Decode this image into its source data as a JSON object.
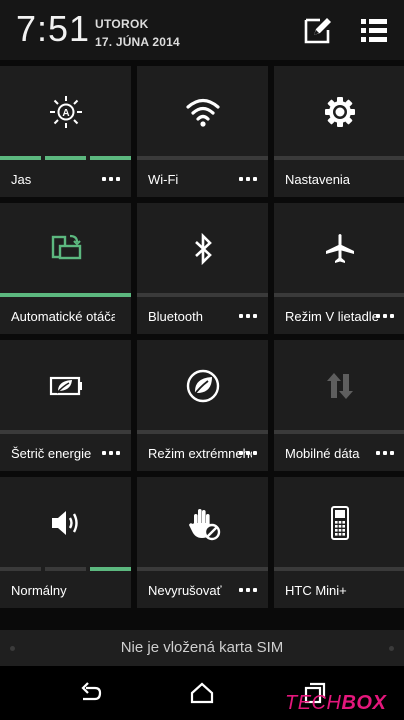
{
  "header": {
    "time": "7:51",
    "day": "UTOROK",
    "date": "17. JÚNA 2014",
    "edit_icon": "edit-icon",
    "menu_icon": "list-menu-icon"
  },
  "tiles": [
    {
      "label": "Jas",
      "icon": "brightness-auto-icon",
      "has_more": true,
      "level_segments_on": 3
    },
    {
      "label": "Wi-Fi",
      "icon": "wifi-icon",
      "has_more": true,
      "enabled": false
    },
    {
      "label": "Nastavenia",
      "icon": "gear-icon",
      "has_more": false,
      "enabled": false
    },
    {
      "label": "Automatické otáčanie",
      "icon": "auto-rotate-icon",
      "has_more": false,
      "enabled": true
    },
    {
      "label": "Bluetooth",
      "icon": "bluetooth-icon",
      "has_more": true,
      "enabled": false
    },
    {
      "label": "Režim V lietadle",
      "icon": "airplane-icon",
      "has_more": true,
      "enabled": false
    },
    {
      "label": "Šetrič energie",
      "icon": "battery-leaf-icon",
      "has_more": true,
      "enabled": false
    },
    {
      "label": "Režim extrémneho šetrenia",
      "icon": "extreme-saver-icon",
      "has_more": true,
      "enabled": false
    },
    {
      "label": "Mobilné dáta",
      "icon": "mobile-data-icon",
      "has_more": true,
      "enabled": false
    },
    {
      "label": "Normálny",
      "icon": "speaker-icon",
      "has_more": false,
      "level_segments_on": 1
    },
    {
      "label": "Nevyrušovať",
      "icon": "do-not-disturb-hand-icon",
      "has_more": true,
      "enabled": false
    },
    {
      "label": "HTC Mini+",
      "icon": "htc-mini-phone-icon",
      "has_more": false,
      "enabled": false
    }
  ],
  "sim_status": "Nie je vložená karta SIM",
  "nav": {
    "back_icon": "back-icon",
    "home_icon": "home-icon",
    "recent_icon": "recent-apps-icon"
  },
  "watermark": {
    "part1": "TECH",
    "part2": "BOX"
  },
  "colors": {
    "accent": "#5cb87f",
    "tile_bg": "#1e1e1e",
    "bar_off": "#3a3a3a",
    "watermark": "#e4177c"
  }
}
